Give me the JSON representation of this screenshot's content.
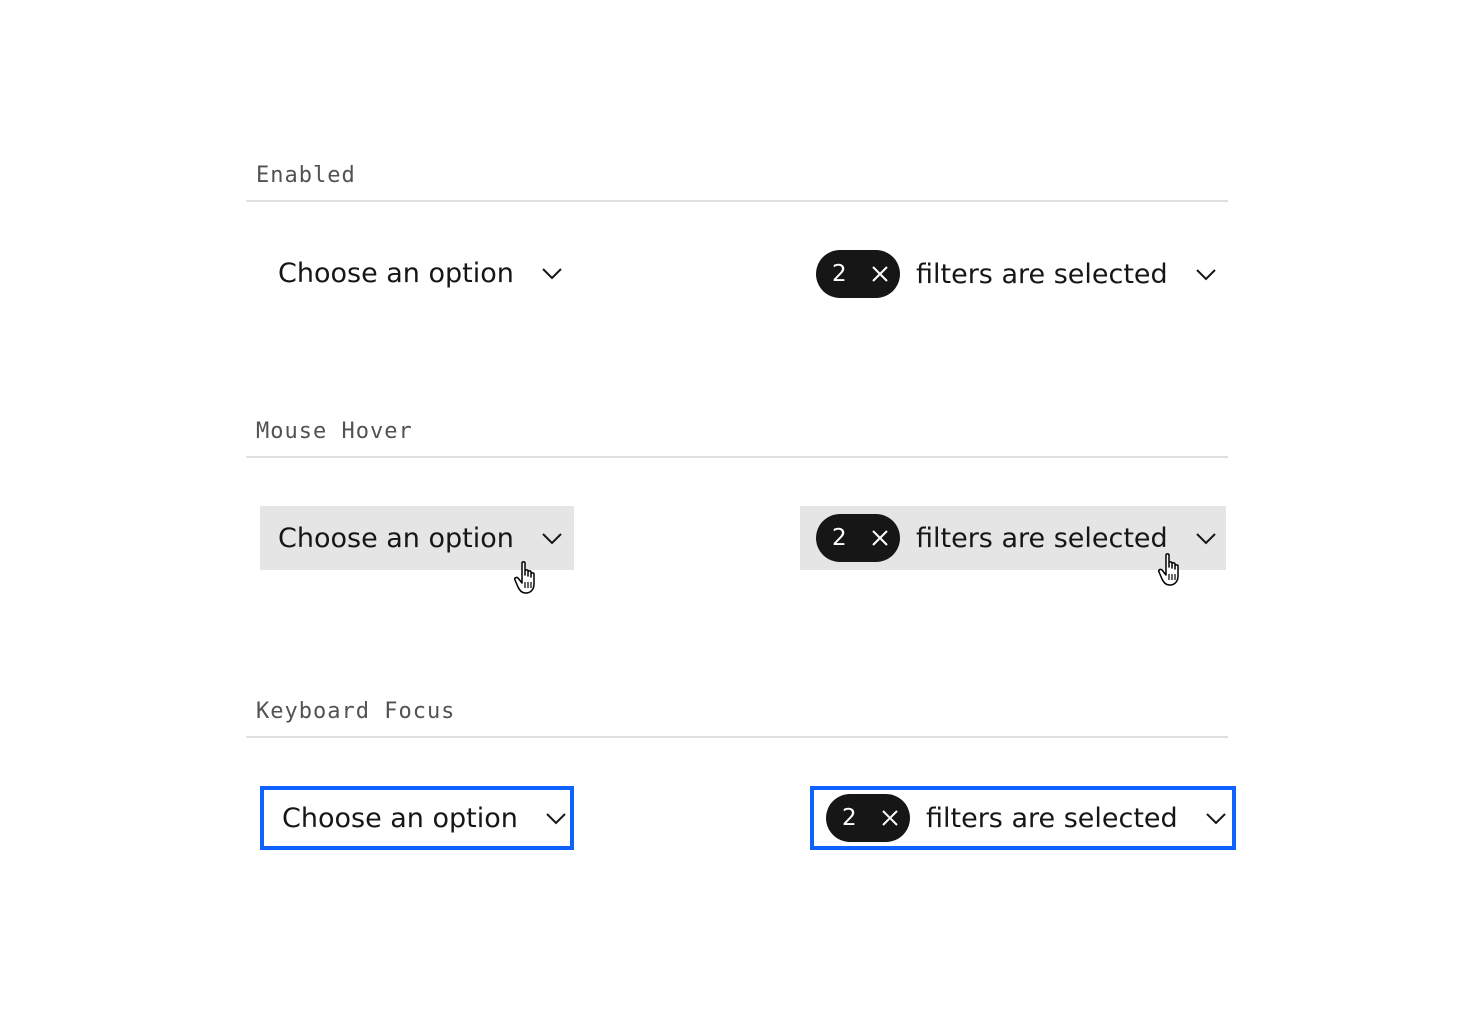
{
  "sections": [
    {
      "title": "Enabled",
      "single": {
        "label": "Choose an option",
        "icon": "chevron-down-icon"
      },
      "multi": {
        "count": "2",
        "label": "filters are selected",
        "clear_icon": "close-icon",
        "icon": "chevron-down-icon"
      }
    },
    {
      "title": "Mouse Hover",
      "single": {
        "label": "Choose an option",
        "icon": "chevron-down-icon"
      },
      "multi": {
        "count": "2",
        "label": "filters are selected",
        "clear_icon": "close-icon",
        "icon": "chevron-down-icon"
      }
    },
    {
      "title": "Keyboard Focus",
      "single": {
        "label": "Choose an option",
        "icon": "chevron-down-icon"
      },
      "multi": {
        "count": "2",
        "label": "filters are selected",
        "clear_icon": "close-icon",
        "icon": "chevron-down-icon"
      }
    }
  ],
  "colors": {
    "text": "#161616",
    "section_label": "#525252",
    "divider": "#e0e0e0",
    "hover_background": "#e5e5e5",
    "focus_border": "#0f62fe",
    "tag_background": "#161616",
    "tag_text": "#ffffff"
  }
}
